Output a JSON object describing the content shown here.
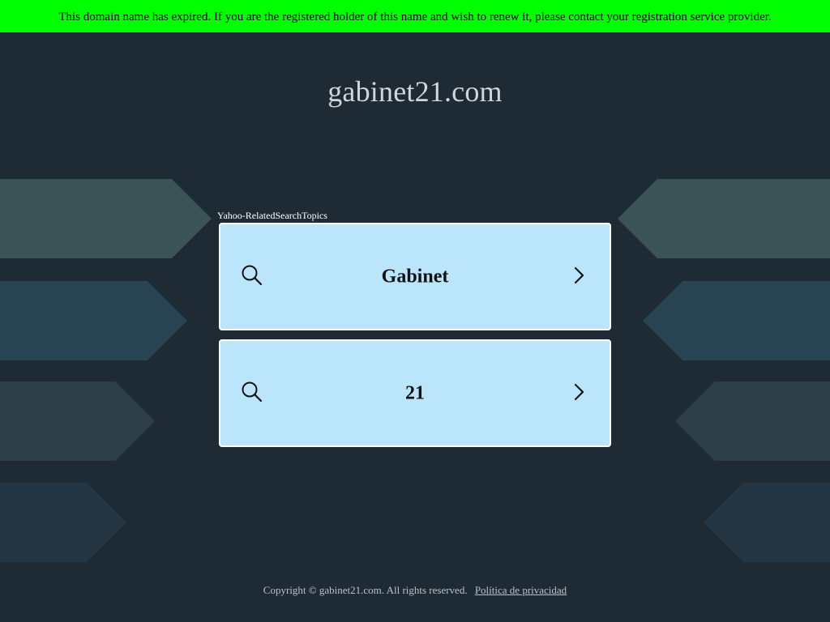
{
  "banner": {
    "text": "This domain name has expired. If you are the registered holder of this name and wish to renew it, please contact your registration service provider."
  },
  "header": {
    "domain": "gabinet21.com"
  },
  "related_searches": {
    "label": "Yahoo-RelatedSearchTopics",
    "items": [
      {
        "label": "Gabinet"
      },
      {
        "label": "21"
      }
    ],
    "icons": [
      "search-icon",
      "chevron-right-icon"
    ]
  },
  "footer": {
    "copyright": "Copyright © gabinet21.com.  All rights reserved.",
    "privacy_link": "Política de privacidad"
  },
  "colors": {
    "banner_bg": "#00ff00",
    "page_bg": "#1e2b35",
    "card_bg": "#bae5fb",
    "card_border": "#ffffff"
  }
}
